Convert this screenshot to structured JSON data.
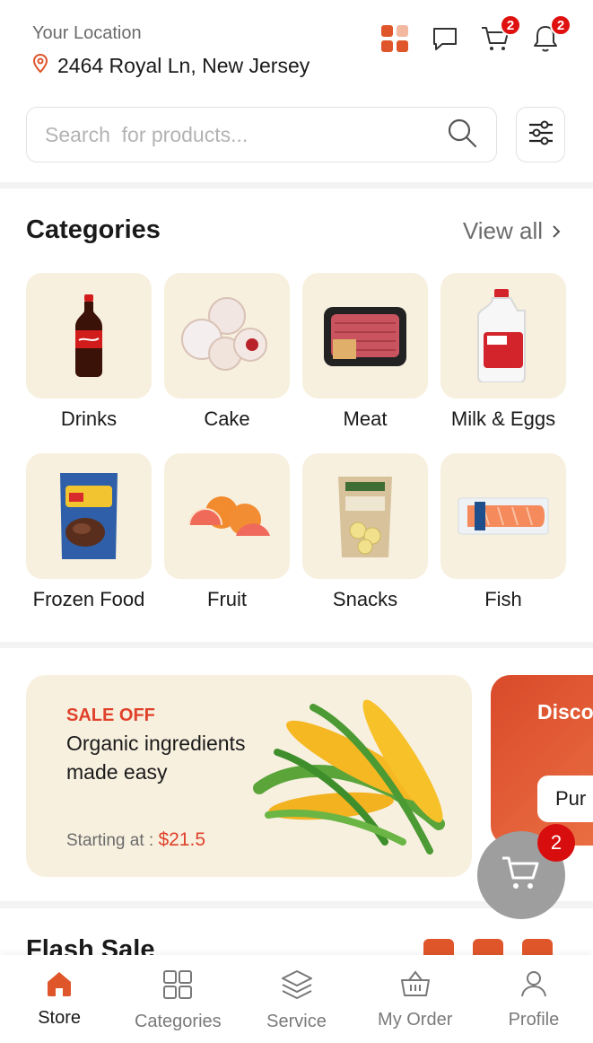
{
  "header": {
    "location_label": "Your Location",
    "address": "2464 Royal Ln, New Jersey",
    "chat_icon": "chat-icon",
    "cart_count": "2",
    "notification_count": "2"
  },
  "search": {
    "placeholder": "Search  for products..."
  },
  "categories": {
    "title": "Categories",
    "view_all": "View all",
    "items": [
      {
        "label": "Drinks",
        "icon": "cola-bottle"
      },
      {
        "label": "Cake",
        "icon": "donuts"
      },
      {
        "label": "Meat",
        "icon": "ground-meat-tray"
      },
      {
        "label": "Milk & Eggs",
        "icon": "milk-jug"
      },
      {
        "label": "Frozen Food",
        "icon": "frozen-food-bag"
      },
      {
        "label": "Fruit",
        "icon": "citrus-fruit"
      },
      {
        "label": "Snacks",
        "icon": "banana-chips-bag"
      },
      {
        "label": "Fish",
        "icon": "salmon-fillet"
      }
    ]
  },
  "promo": {
    "sale_label": "SALE OFF",
    "text": "Organic ingredients made easy",
    "price_label": "Starting at :",
    "price": "$21.5",
    "card2_title": "Disco Produ",
    "card2_button": "Pur"
  },
  "flash": {
    "title": "Flash Sale"
  },
  "floating_cart": {
    "count": "2"
  },
  "nav": {
    "items": [
      {
        "label": "Store",
        "active": true
      },
      {
        "label": "Categories",
        "active": false
      },
      {
        "label": "Service",
        "active": false
      },
      {
        "label": "My Order",
        "active": false
      },
      {
        "label": "Profile",
        "active": false
      }
    ]
  },
  "colors": {
    "accent": "#e0562b",
    "badge": "#e01010",
    "tile_bg": "#f7f0df"
  }
}
